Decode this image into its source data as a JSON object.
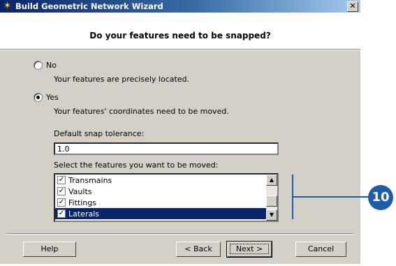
{
  "window": {
    "title": "Build Geometric Network Wizard",
    "close_glyph": "✕"
  },
  "header": {
    "question": "Do your features need to be snapped?"
  },
  "options": {
    "no": {
      "label": "No",
      "description": "Your features are precisely located.",
      "selected": false
    },
    "yes": {
      "label": "Yes",
      "description": "Your features' coordinates need to be moved.",
      "selected": true
    }
  },
  "tolerance": {
    "label": "Default snap tolerance:",
    "value": "1.0"
  },
  "features": {
    "label": "Select the features you want to be moved:",
    "items": [
      {
        "name": "Transmains",
        "checked": true,
        "selected": false
      },
      {
        "name": "Vaults",
        "checked": true,
        "selected": false
      },
      {
        "name": "Fittings",
        "checked": true,
        "selected": false
      },
      {
        "name": "Laterals",
        "checked": true,
        "selected": true
      }
    ]
  },
  "buttons": {
    "help": "Help",
    "back": "< Back",
    "next": "Next >",
    "cancel": "Cancel"
  },
  "callout": {
    "number": "10"
  },
  "colors": {
    "title_start": "#0a246a",
    "selection": "#0a246a",
    "dialog_bg": "#d4d0c8",
    "callout": "#1f5da8"
  },
  "icons": {
    "title": "wizard-icon",
    "check": "checkmark-icon",
    "scroll_up": "scroll-up-arrow-icon",
    "scroll_down": "scroll-down-arrow-icon"
  }
}
